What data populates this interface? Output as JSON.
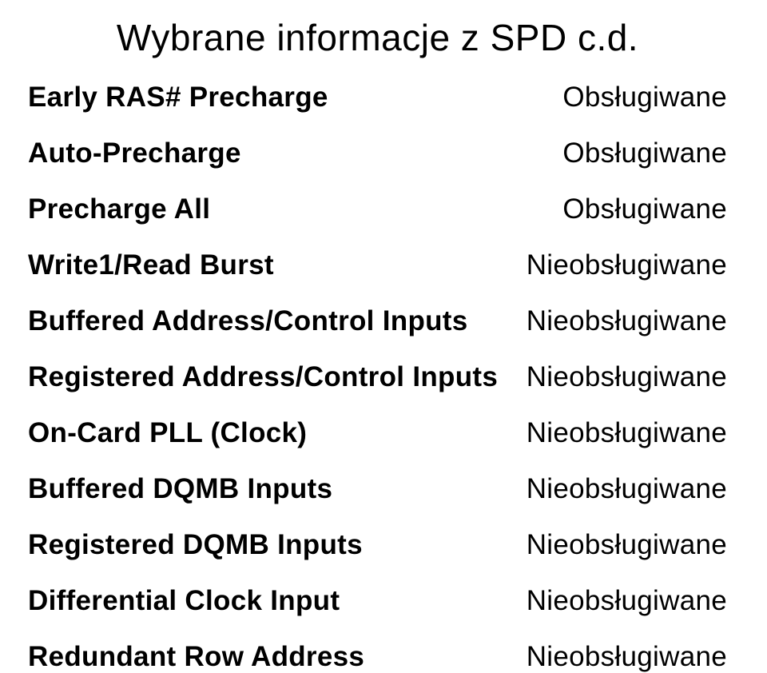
{
  "title": "Wybrane informacje z SPD c.d.",
  "rows": [
    {
      "label": "Early RAS# Precharge",
      "value": "Obsługiwane"
    },
    {
      "label": "Auto-Precharge",
      "value": "Obsługiwane"
    },
    {
      "label": "Precharge All",
      "value": "Obsługiwane"
    },
    {
      "label": "Write1/Read Burst",
      "value": "Nieobsługiwane"
    },
    {
      "label": "Buffered Address/Control Inputs",
      "value": "Nieobsługiwane"
    },
    {
      "label": "Registered Address/Control Inputs",
      "value": "Nieobsługiwane"
    },
    {
      "label": "On-Card PLL (Clock)",
      "value": "Nieobsługiwane"
    },
    {
      "label": "Buffered DQMB Inputs",
      "value": "Nieobsługiwane"
    },
    {
      "label": "Registered DQMB Inputs",
      "value": "Nieobsługiwane"
    },
    {
      "label": "Differential Clock Input",
      "value": "Nieobsługiwane"
    },
    {
      "label": "Redundant Row Address",
      "value": "Nieobsługiwane"
    }
  ]
}
